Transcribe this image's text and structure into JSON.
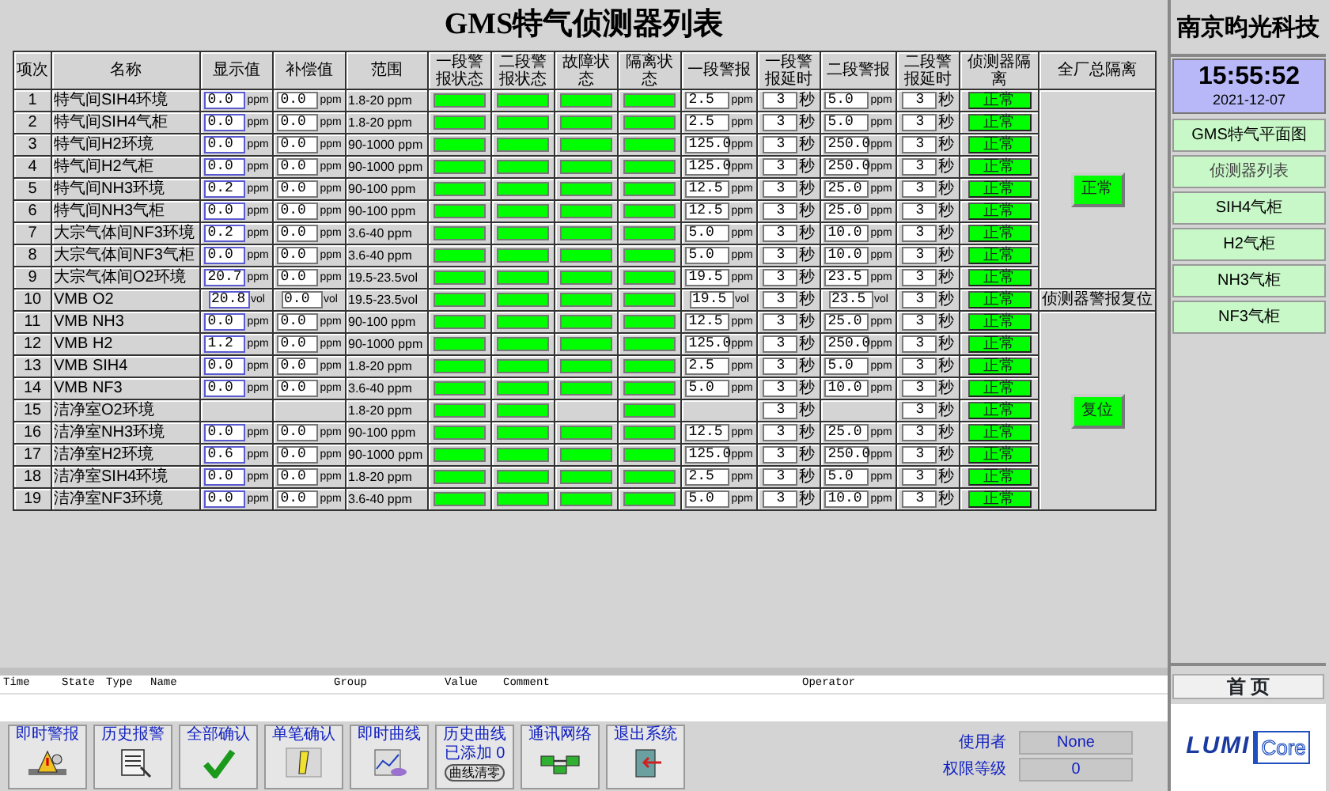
{
  "title": "GMS特气侦测器列表",
  "columns": [
    "项次",
    "名称",
    "显示值",
    "补偿值",
    "范围",
    "一段警报状态",
    "二段警报状态",
    "故障状态",
    "隔离状态",
    "一段警报",
    "一段警报延时",
    "二段警报",
    "二段警报延时",
    "侦测器隔离",
    "全厂总隔离"
  ],
  "row_groups": [
    {
      "side": {
        "kind": "button",
        "label": "正常"
      },
      "rows": [
        {
          "no": "1",
          "name": "特气间SIH4环境",
          "display": {
            "value": "0.0",
            "unit": "ppm"
          },
          "comp": {
            "value": "0.0",
            "unit": "ppm"
          },
          "range": "1.8-20 ppm",
          "status_alarm1": true,
          "status_alarm2": true,
          "status_fault": true,
          "status_isolation": true,
          "alarm1": {
            "value": "2.5",
            "unit": "ppm"
          },
          "delay1": {
            "value": "3",
            "unit": "秒"
          },
          "alarm2": {
            "value": "5.0",
            "unit": "ppm"
          },
          "delay2": {
            "value": "3",
            "unit": "秒"
          },
          "isolation": "正常"
        },
        {
          "no": "2",
          "name": "特气间SIH4气柜",
          "display": {
            "value": "0.0",
            "unit": "ppm"
          },
          "comp": {
            "value": "0.0",
            "unit": "ppm"
          },
          "range": "1.8-20 ppm",
          "status_alarm1": true,
          "status_alarm2": true,
          "status_fault": true,
          "status_isolation": true,
          "alarm1": {
            "value": "2.5",
            "unit": "ppm"
          },
          "delay1": {
            "value": "3",
            "unit": "秒"
          },
          "alarm2": {
            "value": "5.0",
            "unit": "ppm"
          },
          "delay2": {
            "value": "3",
            "unit": "秒"
          },
          "isolation": "正常"
        },
        {
          "no": "3",
          "name": "特气间H2环境",
          "display": {
            "value": "0.0",
            "unit": "ppm"
          },
          "comp": {
            "value": "0.0",
            "unit": "ppm"
          },
          "range": "90-1000 ppm",
          "status_alarm1": true,
          "status_alarm2": true,
          "status_fault": true,
          "status_isolation": true,
          "alarm1": {
            "value": "125.0",
            "unit": "ppm"
          },
          "delay1": {
            "value": "3",
            "unit": "秒"
          },
          "alarm2": {
            "value": "250.0",
            "unit": "ppm"
          },
          "delay2": {
            "value": "3",
            "unit": "秒"
          },
          "isolation": "正常"
        },
        {
          "no": "4",
          "name": "特气间H2气柜",
          "display": {
            "value": "0.0",
            "unit": "ppm"
          },
          "comp": {
            "value": "0.0",
            "unit": "ppm"
          },
          "range": "90-1000 ppm",
          "status_alarm1": true,
          "status_alarm2": true,
          "status_fault": true,
          "status_isolation": true,
          "alarm1": {
            "value": "125.0",
            "unit": "ppm"
          },
          "delay1": {
            "value": "3",
            "unit": "秒"
          },
          "alarm2": {
            "value": "250.0",
            "unit": "ppm"
          },
          "delay2": {
            "value": "3",
            "unit": "秒"
          },
          "isolation": "正常"
        },
        {
          "no": "5",
          "name": "特气间NH3环境",
          "display": {
            "value": "0.2",
            "unit": "ppm"
          },
          "comp": {
            "value": "0.0",
            "unit": "ppm"
          },
          "range": "90-100 ppm",
          "status_alarm1": true,
          "status_alarm2": true,
          "status_fault": true,
          "status_isolation": true,
          "alarm1": {
            "value": "12.5",
            "unit": "ppm"
          },
          "delay1": {
            "value": "3",
            "unit": "秒"
          },
          "alarm2": {
            "value": "25.0",
            "unit": "ppm"
          },
          "delay2": {
            "value": "3",
            "unit": "秒"
          },
          "isolation": "正常"
        },
        {
          "no": "6",
          "name": "特气间NH3气柜",
          "display": {
            "value": "0.0",
            "unit": "ppm"
          },
          "comp": {
            "value": "0.0",
            "unit": "ppm"
          },
          "range": "90-100 ppm",
          "status_alarm1": true,
          "status_alarm2": true,
          "status_fault": true,
          "status_isolation": true,
          "alarm1": {
            "value": "12.5",
            "unit": "ppm"
          },
          "delay1": {
            "value": "3",
            "unit": "秒"
          },
          "alarm2": {
            "value": "25.0",
            "unit": "ppm"
          },
          "delay2": {
            "value": "3",
            "unit": "秒"
          },
          "isolation": "正常"
        },
        {
          "no": "7",
          "name": "大宗气体间NF3环境",
          "display": {
            "value": "0.2",
            "unit": "ppm"
          },
          "comp": {
            "value": "0.0",
            "unit": "ppm"
          },
          "range": "3.6-40 ppm",
          "status_alarm1": true,
          "status_alarm2": true,
          "status_fault": true,
          "status_isolation": true,
          "alarm1": {
            "value": "5.0",
            "unit": "ppm"
          },
          "delay1": {
            "value": "3",
            "unit": "秒"
          },
          "alarm2": {
            "value": "10.0",
            "unit": "ppm"
          },
          "delay2": {
            "value": "3",
            "unit": "秒"
          },
          "isolation": "正常"
        },
        {
          "no": "8",
          "name": "大宗气体间NF3气柜",
          "display": {
            "value": "0.0",
            "unit": "ppm"
          },
          "comp": {
            "value": "0.0",
            "unit": "ppm"
          },
          "range": "3.6-40 ppm",
          "status_alarm1": true,
          "status_alarm2": true,
          "status_fault": true,
          "status_isolation": true,
          "alarm1": {
            "value": "5.0",
            "unit": "ppm"
          },
          "delay1": {
            "value": "3",
            "unit": "秒"
          },
          "alarm2": {
            "value": "10.0",
            "unit": "ppm"
          },
          "delay2": {
            "value": "3",
            "unit": "秒"
          },
          "isolation": "正常"
        },
        {
          "no": "9",
          "name": "大宗气体间O2环境",
          "display": {
            "value": "20.7",
            "unit": "ppm"
          },
          "comp": {
            "value": "0.0",
            "unit": "ppm"
          },
          "range": "19.5-23.5vol",
          "status_alarm1": true,
          "status_alarm2": true,
          "status_fault": true,
          "status_isolation": true,
          "alarm1": {
            "value": "19.5",
            "unit": "ppm"
          },
          "delay1": {
            "value": "3",
            "unit": "秒"
          },
          "alarm2": {
            "value": "23.5",
            "unit": "ppm"
          },
          "delay2": {
            "value": "3",
            "unit": "秒"
          },
          "isolation": "正常"
        }
      ]
    },
    {
      "side": {
        "kind": "text",
        "label": "侦测器警报复位"
      },
      "rows": [
        {
          "no": "10",
          "name": "VMB O2",
          "display": {
            "value": "20.8",
            "unit": "vol"
          },
          "comp": {
            "value": "0.0",
            "unit": "vol"
          },
          "range": "19.5-23.5vol",
          "status_alarm1": true,
          "status_alarm2": true,
          "status_fault": true,
          "status_isolation": true,
          "alarm1": {
            "value": "19.5",
            "unit": "vol"
          },
          "delay1": {
            "value": "3",
            "unit": "秒"
          },
          "alarm2": {
            "value": "23.5",
            "unit": "vol"
          },
          "delay2": {
            "value": "3",
            "unit": "秒"
          },
          "isolation": "正常"
        }
      ]
    },
    {
      "side": {
        "kind": "button",
        "label": "复位"
      },
      "rows": [
        {
          "no": "11",
          "name": "VMB NH3",
          "display": {
            "value": "0.0",
            "unit": "ppm"
          },
          "comp": {
            "value": "0.0",
            "unit": "ppm"
          },
          "range": "90-100 ppm",
          "status_alarm1": true,
          "status_alarm2": true,
          "status_fault": true,
          "status_isolation": true,
          "alarm1": {
            "value": "12.5",
            "unit": "ppm"
          },
          "delay1": {
            "value": "3",
            "unit": "秒"
          },
          "alarm2": {
            "value": "25.0",
            "unit": "ppm"
          },
          "delay2": {
            "value": "3",
            "unit": "秒"
          },
          "isolation": "正常"
        },
        {
          "no": "12",
          "name": "VMB H2",
          "display": {
            "value": "1.2",
            "unit": "ppm"
          },
          "comp": {
            "value": "0.0",
            "unit": "ppm"
          },
          "range": "90-1000 ppm",
          "status_alarm1": true,
          "status_alarm2": true,
          "status_fault": true,
          "status_isolation": true,
          "alarm1": {
            "value": "125.0",
            "unit": "ppm"
          },
          "delay1": {
            "value": "3",
            "unit": "秒"
          },
          "alarm2": {
            "value": "250.0",
            "unit": "ppm"
          },
          "delay2": {
            "value": "3",
            "unit": "秒"
          },
          "isolation": "正常"
        },
        {
          "no": "13",
          "name": "VMB SIH4",
          "display": {
            "value": "0.0",
            "unit": "ppm"
          },
          "comp": {
            "value": "0.0",
            "unit": "ppm"
          },
          "range": "1.8-20 ppm",
          "status_alarm1": true,
          "status_alarm2": true,
          "status_fault": true,
          "status_isolation": true,
          "alarm1": {
            "value": "2.5",
            "unit": "ppm"
          },
          "delay1": {
            "value": "3",
            "unit": "秒"
          },
          "alarm2": {
            "value": "5.0",
            "unit": "ppm"
          },
          "delay2": {
            "value": "3",
            "unit": "秒"
          },
          "isolation": "正常"
        },
        {
          "no": "14",
          "name": "VMB NF3",
          "display": {
            "value": "0.0",
            "unit": "ppm"
          },
          "comp": {
            "value": "0.0",
            "unit": "ppm"
          },
          "range": "3.6-40 ppm",
          "status_alarm1": true,
          "status_alarm2": true,
          "status_fault": true,
          "status_isolation": true,
          "alarm1": {
            "value": "5.0",
            "unit": "ppm"
          },
          "delay1": {
            "value": "3",
            "unit": "秒"
          },
          "alarm2": {
            "value": "10.0",
            "unit": "ppm"
          },
          "delay2": {
            "value": "3",
            "unit": "秒"
          },
          "isolation": "正常"
        },
        {
          "no": "15",
          "name": "洁净室O2环境",
          "range": "1.8-20 ppm",
          "status_alarm1": true,
          "status_alarm2": true,
          "status_isolation": true,
          "delay1": {
            "value": "3",
            "unit": "秒"
          },
          "delay2": {
            "value": "3",
            "unit": "秒"
          },
          "isolation": "正常"
        },
        {
          "no": "16",
          "name": "洁净室NH3环境",
          "display": {
            "value": "0.0",
            "unit": "ppm"
          },
          "comp": {
            "value": "0.0",
            "unit": "ppm"
          },
          "range": "90-100 ppm",
          "status_alarm1": true,
          "status_alarm2": true,
          "status_fault": true,
          "status_isolation": true,
          "alarm1": {
            "value": "12.5",
            "unit": "ppm"
          },
          "delay1": {
            "value": "3",
            "unit": "秒"
          },
          "alarm2": {
            "value": "25.0",
            "unit": "ppm"
          },
          "delay2": {
            "value": "3",
            "unit": "秒"
          },
          "isolation": "正常"
        },
        {
          "no": "17",
          "name": "洁净室H2环境",
          "display": {
            "value": "0.6",
            "unit": "ppm"
          },
          "comp": {
            "value": "0.0",
            "unit": "ppm"
          },
          "range": "90-1000 ppm",
          "status_alarm1": true,
          "status_alarm2": true,
          "status_fault": true,
          "status_isolation": true,
          "alarm1": {
            "value": "125.0",
            "unit": "ppm"
          },
          "delay1": {
            "value": "3",
            "unit": "秒"
          },
          "alarm2": {
            "value": "250.0",
            "unit": "ppm"
          },
          "delay2": {
            "value": "3",
            "unit": "秒"
          },
          "isolation": "正常"
        },
        {
          "no": "18",
          "name": "洁净室SIH4环境",
          "display": {
            "value": "0.0",
            "unit": "ppm"
          },
          "comp": {
            "value": "0.0",
            "unit": "ppm"
          },
          "range": "1.8-20 ppm",
          "status_alarm1": true,
          "status_alarm2": true,
          "status_fault": true,
          "status_isolation": true,
          "alarm1": {
            "value": "2.5",
            "unit": "ppm"
          },
          "delay1": {
            "value": "3",
            "unit": "秒"
          },
          "alarm2": {
            "value": "5.0",
            "unit": "ppm"
          },
          "delay2": {
            "value": "3",
            "unit": "秒"
          },
          "isolation": "正常"
        },
        {
          "no": "19",
          "name": "洁净室NF3环境",
          "display": {
            "value": "0.0",
            "unit": "ppm"
          },
          "comp": {
            "value": "0.0",
            "unit": "ppm"
          },
          "range": "3.6-40 ppm",
          "status_alarm1": true,
          "status_alarm2": true,
          "status_fault": true,
          "status_isolation": true,
          "alarm1": {
            "value": "5.0",
            "unit": "ppm"
          },
          "delay1": {
            "value": "3",
            "unit": "秒"
          },
          "alarm2": {
            "value": "10.0",
            "unit": "ppm"
          },
          "delay2": {
            "value": "3",
            "unit": "秒"
          },
          "isolation": "正常"
        }
      ]
    }
  ],
  "event_log": {
    "columns": [
      "Time",
      "State",
      "Type",
      "Name",
      "Group",
      "Value",
      "Comment",
      "Operator"
    ]
  },
  "toolbar": [
    {
      "kind": "alarm",
      "label": "即时警报"
    },
    {
      "kind": "history",
      "label": "历史报警"
    },
    {
      "kind": "ack_all",
      "label": "全部确认"
    },
    {
      "kind": "ack_one",
      "label": "单笔确认"
    },
    {
      "kind": "trend",
      "label": "即时曲线"
    },
    {
      "kind": "history_trend",
      "label": "历史曲线",
      "note": "已添加 0",
      "sub_button": "曲线清零"
    },
    {
      "kind": "network",
      "label": "通讯网络"
    },
    {
      "kind": "exit",
      "label": "退出系统"
    }
  ],
  "user": {
    "user_label": "使用者",
    "user_value": "None",
    "level_label": "权限等级",
    "level_value": "0"
  },
  "sidebar": {
    "brand": "南京昀光科技",
    "time": "15:55:52",
    "date": "2021-12-07",
    "items": [
      {
        "label": "GMS特气平面图",
        "selected": false
      },
      {
        "label": "侦测器列表",
        "selected": true
      },
      {
        "label": "SIH4气柜",
        "selected": false
      },
      {
        "label": "H2气柜",
        "selected": false
      },
      {
        "label": "NH3气柜",
        "selected": false
      },
      {
        "label": "NF3气柜",
        "selected": false
      }
    ],
    "home": "首 页",
    "logo": {
      "part1": "LUMI",
      "part2": "Core"
    }
  }
}
